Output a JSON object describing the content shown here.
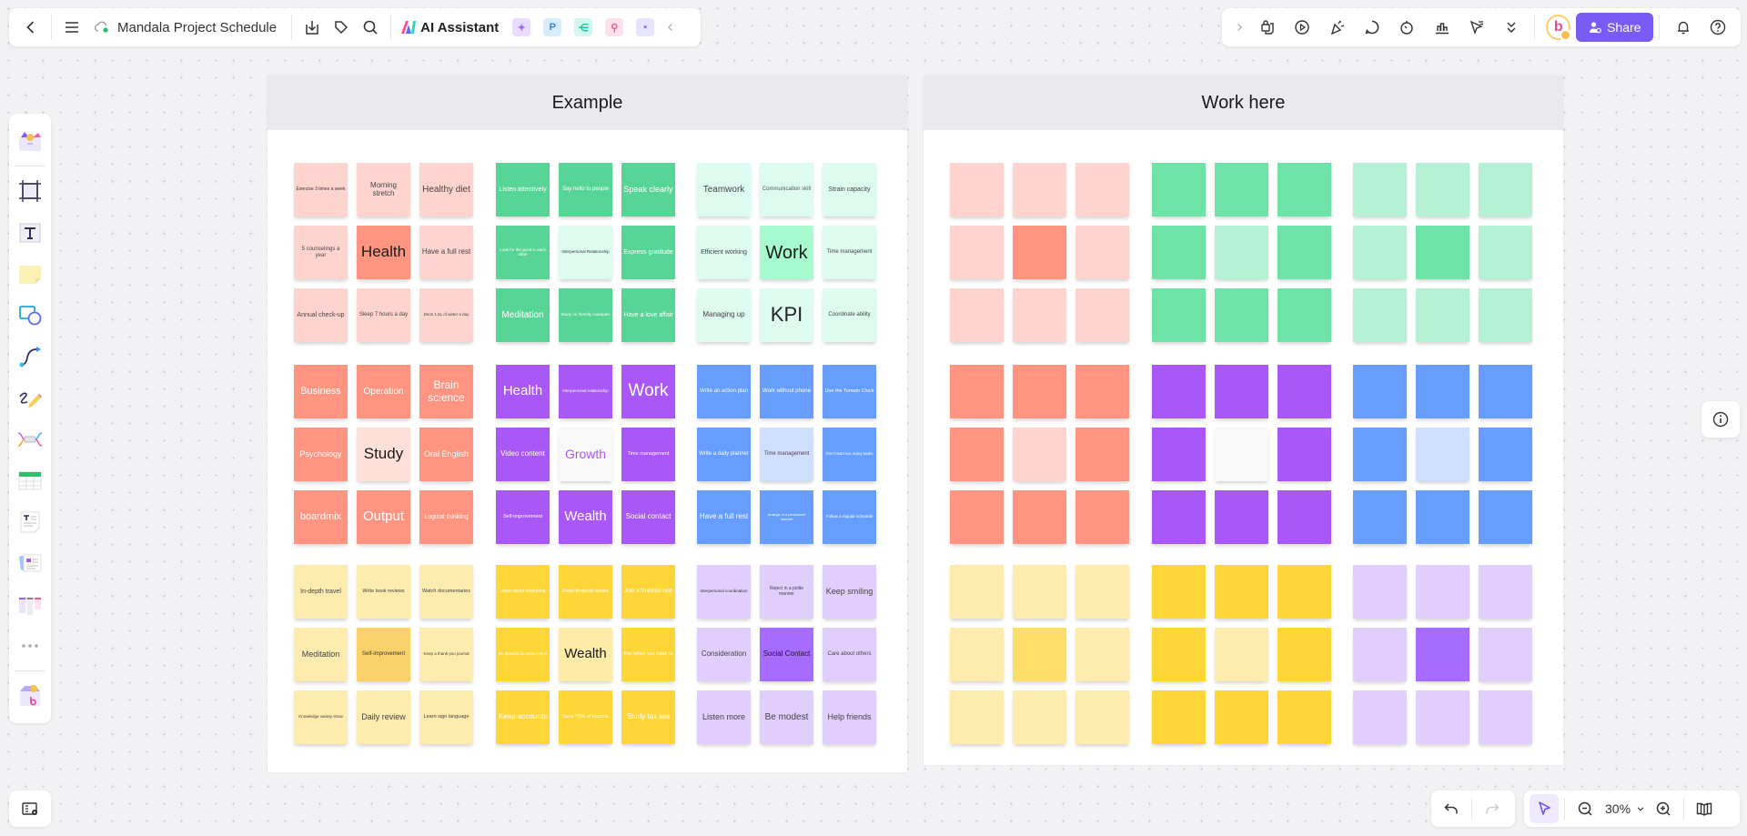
{
  "header": {
    "back_icon": "chevron-left-icon",
    "menu_icon": "hamburger-icon",
    "cloud_status_icon": "cloud-synced-icon",
    "title": "Mandala Project Schedule",
    "ai_assistant_label": "AI Assistant",
    "apps": [
      {
        "name": "ai-image",
        "glyph": "✦",
        "bg": "#e9dbff",
        "fg": "#9b6bf5"
      },
      {
        "name": "presentation",
        "glyph": "P",
        "bg": "#d8ecff",
        "fg": "#2c86f0"
      },
      {
        "name": "mindmap",
        "glyph": "⋲",
        "bg": "#d3f6ee",
        "fg": "#12c2a0"
      },
      {
        "name": "flowchart",
        "glyph": "⚲",
        "bg": "#ffe0ec",
        "fg": "#ef5b8f"
      },
      {
        "name": "chat",
        "glyph": "▪",
        "bg": "#e5e5ff",
        "fg": "#7b72ef"
      }
    ]
  },
  "toolbar_right": {
    "share_label": "Share",
    "avatar_letter": "b"
  },
  "zoom": {
    "level": "30%"
  },
  "frames": [
    {
      "title": "Example",
      "blocks": [
        {
          "cells": [
            {
              "text": "Exercise 3 times a week",
              "bg": "#ffd4ce",
              "fg": "#333",
              "size": 5
            },
            {
              "text": "Morning stretch",
              "bg": "#ffd4ce",
              "fg": "#444",
              "size": 8
            },
            {
              "text": "Healthy diet",
              "bg": "#ffd4ce",
              "fg": "#444",
              "size": 10
            },
            {
              "text": "5 counselings a year",
              "bg": "#ffd4ce",
              "fg": "#444",
              "size": 6
            },
            {
              "text": "Health",
              "bg": "#ff9480",
              "fg": "#1a1a1a",
              "size": 17
            },
            {
              "text": "Have a full rest",
              "bg": "#ffd4ce",
              "fg": "#444",
              "size": 8
            },
            {
              "text": "Annual check-up",
              "bg": "#ffd4ce",
              "fg": "#444",
              "size": 7
            },
            {
              "text": "Sleep 7 hours a day",
              "bg": "#ffd4ce",
              "fg": "#444",
              "size": 6
            },
            {
              "text": "Drink 1.5L of water a day",
              "bg": "#ffd4ce",
              "fg": "#444",
              "size": 4.5
            }
          ]
        },
        {
          "cells": [
            {
              "text": "Listen attentively",
              "bg": "#57d596",
              "fg": "#fff",
              "size": 7
            },
            {
              "text": "Say hello to people",
              "bg": "#57d596",
              "fg": "#fff",
              "size": 6
            },
            {
              "text": "Speak clearly",
              "bg": "#57d596",
              "fg": "#fff",
              "size": 9
            },
            {
              "text": "Look for the good in each other",
              "bg": "#57d596",
              "fg": "#fff",
              "size": 4.5
            },
            {
              "text": "Interpersonal Relationship",
              "bg": "#ddfbef",
              "fg": "#333",
              "size": 4.5
            },
            {
              "text": "Express gratitude",
              "bg": "#57d596",
              "fg": "#fff",
              "size": 7
            },
            {
              "text": "Meditation",
              "bg": "#57d596",
              "fg": "#fff",
              "size": 10
            },
            {
              "text": "Study on friendly examples",
              "bg": "#57d596",
              "fg": "#fff",
              "size": 4.5
            },
            {
              "text": "Have a love affair",
              "bg": "#57d596",
              "fg": "#fff",
              "size": 7
            }
          ]
        },
        {
          "cells": [
            {
              "text": "Teamwork",
              "bg": "#ddfbef",
              "fg": "#444",
              "size": 10
            },
            {
              "text": "Communication skill",
              "bg": "#ddfbef",
              "fg": "#555",
              "size": 6
            },
            {
              "text": "Strain capacity",
              "bg": "#ddfbef",
              "fg": "#444",
              "size": 7
            },
            {
              "text": "Efficient working",
              "bg": "#ddfbef",
              "fg": "#444",
              "size": 7
            },
            {
              "text": "Work",
              "bg": "#a6fbcf",
              "fg": "#1a1a1a",
              "size": 20
            },
            {
              "text": "Time management",
              "bg": "#ddfbef",
              "fg": "#444",
              "size": 6
            },
            {
              "text": "Managing up",
              "bg": "#ddfbef",
              "fg": "#444",
              "size": 8
            },
            {
              "text": "KPI",
              "bg": "#ddfbef",
              "fg": "#222",
              "size": 22
            },
            {
              "text": "Coordinate ability",
              "bg": "#ddfbef",
              "fg": "#444",
              "size": 6
            }
          ]
        },
        {
          "cells": [
            {
              "text": "Business",
              "bg": "#ff9480",
              "fg": "#fff",
              "size": 11
            },
            {
              "text": "Operation",
              "bg": "#ff9480",
              "fg": "#fff",
              "size": 10
            },
            {
              "text": "Brain science",
              "bg": "#ff9480",
              "fg": "#fff",
              "size": 12
            },
            {
              "text": "Psychology",
              "bg": "#ff9480",
              "fg": "#fff",
              "size": 9
            },
            {
              "text": "Study",
              "bg": "#ffe0d8",
              "fg": "#1a1a1a",
              "size": 17
            },
            {
              "text": "Oral English",
              "bg": "#ff9480",
              "fg": "#fff",
              "size": 9
            },
            {
              "text": "boardmix",
              "bg": "#ff9480",
              "fg": "#fff",
              "size": 11
            },
            {
              "text": "Output",
              "bg": "#ff9480",
              "fg": "#fff",
              "size": 15
            },
            {
              "text": "Logical thinking",
              "bg": "#ff9480",
              "fg": "#fff",
              "size": 7
            }
          ]
        },
        {
          "cells": [
            {
              "text": "Health",
              "bg": "#a957f7",
              "fg": "#fff",
              "size": 15
            },
            {
              "text": "Interpersonal relationship",
              "bg": "#a957f7",
              "fg": "#fff",
              "size": 4.5
            },
            {
              "text": "Work",
              "bg": "#a957f7",
              "fg": "#fff",
              "size": 19
            },
            {
              "text": "Video content",
              "bg": "#a957f7",
              "fg": "#fff",
              "size": 8
            },
            {
              "text": "Growth",
              "bg": "#f8f8f8",
              "fg": "#a957f7",
              "size": 14
            },
            {
              "text": "Time management",
              "bg": "#a957f7",
              "fg": "#fff",
              "size": 5.5
            },
            {
              "text": "Self-improvement",
              "bg": "#a957f7",
              "fg": "#fff",
              "size": 5.5
            },
            {
              "text": "Wealth",
              "bg": "#a957f7",
              "fg": "#fff",
              "size": 15
            },
            {
              "text": "Social contact",
              "bg": "#a957f7",
              "fg": "#fff",
              "size": 8
            }
          ]
        },
        {
          "cells": [
            {
              "text": "Write an action plan",
              "bg": "#669dff",
              "fg": "#fff",
              "size": 6
            },
            {
              "text": "Work without phone",
              "bg": "#669dff",
              "fg": "#fff",
              "size": 6
            },
            {
              "text": "Use the Tomato Clock",
              "bg": "#669dff",
              "fg": "#fff",
              "size": 5.5
            },
            {
              "text": "Write a daily planner",
              "bg": "#669dff",
              "fg": "#fff",
              "size": 6
            },
            {
              "text": "Time management",
              "bg": "#cfdfff",
              "fg": "#5a3a5a",
              "size": 6
            },
            {
              "text": "Don't start too many tasks",
              "bg": "#669dff",
              "fg": "#fff",
              "size": 4.5
            },
            {
              "text": "Have a full rest",
              "bg": "#669dff",
              "fg": "#fff",
              "size": 8
            },
            {
              "text": "Arrange in a permanent manner",
              "bg": "#669dff",
              "fg": "#fff",
              "size": 4
            },
            {
              "text": "Follow a regular schedule",
              "bg": "#669dff",
              "fg": "#fff",
              "size": 4.5
            }
          ]
        },
        {
          "cells": [
            {
              "text": "In-depth travel",
              "bg": "#feebae",
              "fg": "#444",
              "size": 7
            },
            {
              "text": "Write book reviews",
              "bg": "#feebae",
              "fg": "#444",
              "size": 5.5
            },
            {
              "text": "Watch documentaries",
              "bg": "#feebae",
              "fg": "#444",
              "size": 5.5
            },
            {
              "text": "Meditation",
              "bg": "#feebae",
              "fg": "#444",
              "size": 9
            },
            {
              "text": "Self-improvement",
              "bg": "#fbd269",
              "fg": "#333",
              "size": 6
            },
            {
              "text": "Keep a thank-you journal",
              "bg": "#feebae",
              "fg": "#444",
              "size": 4.5
            },
            {
              "text": "Knowledge variety show",
              "bg": "#feebae",
              "fg": "#444",
              "size": 4.5
            },
            {
              "text": "Daily review",
              "bg": "#feebae",
              "fg": "#444",
              "size": 9
            },
            {
              "text": "Learn sign language",
              "bg": "#feebae",
              "fg": "#444",
              "size": 5.5
            }
          ]
        },
        {
          "cells": [
            {
              "text": "Learn about marketing",
              "bg": "#ffd637",
              "fg": "#fff",
              "size": 5
            },
            {
              "text": "Read financial books",
              "bg": "#ffd637",
              "fg": "#fff",
              "size": 5.5
            },
            {
              "text": "Join a financial club",
              "bg": "#ffd637",
              "fg": "#fff",
              "size": 6
            },
            {
              "text": "Be thankful for what I have",
              "bg": "#ffd637",
              "fg": "#fff",
              "size": 4.5
            },
            {
              "text": "Wealth",
              "bg": "#feeba8",
              "fg": "#1a1a1a",
              "size": 15
            },
            {
              "text": "Pay when you have to",
              "bg": "#ffd637",
              "fg": "#fff",
              "size": 5.5
            },
            {
              "text": "Keep accounts",
              "bg": "#ffd637",
              "fg": "#fff",
              "size": 8
            },
            {
              "text": "Save 70% of income",
              "bg": "#ffd637",
              "fg": "#fff",
              "size": 5.5
            },
            {
              "text": "Study tax law",
              "bg": "#ffd637",
              "fg": "#fff",
              "size": 8
            }
          ]
        },
        {
          "cells": [
            {
              "text": "Interpersonal coordination",
              "bg": "#e0cffd",
              "fg": "#333",
              "size": 4.5
            },
            {
              "text": "Reject in a polite manner",
              "bg": "#e0cffd",
              "fg": "#444",
              "size": 5
            },
            {
              "text": "Keep smiling",
              "bg": "#e0cffd",
              "fg": "#444",
              "size": 9
            },
            {
              "text": "Consideration",
              "bg": "#e0cffd",
              "fg": "#444",
              "size": 8
            },
            {
              "text": "Social Contact",
              "bg": "#a66bff",
              "fg": "#1a1a1a",
              "size": 8
            },
            {
              "text": "Care about others",
              "bg": "#e0cffd",
              "fg": "#444",
              "size": 6
            },
            {
              "text": "Listen more",
              "bg": "#e0cffd",
              "fg": "#444",
              "size": 9
            },
            {
              "text": "Be modest",
              "bg": "#e0cffd",
              "fg": "#444",
              "size": 10
            },
            {
              "text": "Help friends",
              "bg": "#e0cffd",
              "fg": "#444",
              "size": 9
            }
          ]
        }
      ]
    },
    {
      "title": "Work here",
      "blocks": [
        {
          "outer": "#ffd4ce",
          "center": "#ff9480"
        },
        {
          "outer": "#6de3a7",
          "center": "#b5f2d5"
        },
        {
          "outer": "#b5f2d5",
          "center": "#6de3a7"
        },
        {
          "outer": "#ff9480",
          "center": "#ffd4ce"
        },
        {
          "outer": "#a957f7",
          "center": "#f8f8f8"
        },
        {
          "outer": "#669dff",
          "center": "#cfdfff"
        },
        {
          "outer": "#feebae",
          "center": "#fede68"
        },
        {
          "outer": "#ffd637",
          "center": "#feebae"
        },
        {
          "outer": "#e0cffd",
          "center": "#a66bff"
        }
      ]
    }
  ]
}
